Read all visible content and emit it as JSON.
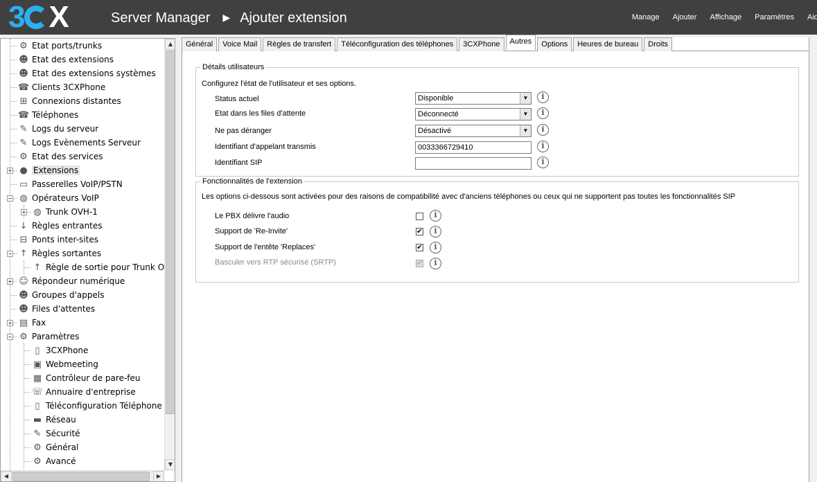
{
  "header": {
    "logo_left": "3",
    "logo_right": "X",
    "app_title": "Server Manager",
    "page_title": "Ajouter extension",
    "menu": [
      "Manage",
      "Ajouter",
      "Affichage",
      "Paramètres",
      "Aide"
    ]
  },
  "sidebar": {
    "items": [
      {
        "label": "Etat ports/trunks",
        "icon": "ports-icon"
      },
      {
        "label": "Etat des extensions",
        "icon": "extensions-status-icon"
      },
      {
        "label": "Etat des extensions systèmes",
        "icon": "system-extensions-icon"
      },
      {
        "label": "Clients 3CXPhone",
        "icon": "clients-icon"
      },
      {
        "label": "Connexions distantes",
        "icon": "network-icon"
      },
      {
        "label": "Téléphones",
        "icon": "phone-icon"
      },
      {
        "label": "Logs du serveur",
        "icon": "log-icon"
      },
      {
        "label": "Logs Evènements Serveur",
        "icon": "event-log-icon"
      },
      {
        "label": "Etat des services",
        "icon": "services-icon"
      },
      {
        "label": "Extensions",
        "icon": "user-icon"
      },
      {
        "label": "Passerelles VoIP/PSTN",
        "icon": "gateway-icon"
      },
      {
        "label": "Opérateurs VoIP",
        "icon": "globe-icon"
      },
      {
        "label": "Trunk OVH-1",
        "icon": "globe-icon"
      },
      {
        "label": "Règles entrantes",
        "icon": "arrow-down-icon"
      },
      {
        "label": "Ponts inter-sites",
        "icon": "bridge-icon"
      },
      {
        "label": "Règles sortantes",
        "icon": "arrow-up-icon"
      },
      {
        "label": "Règle de sortie pour Trunk O",
        "icon": "arrow-up-icon"
      },
      {
        "label": "Répondeur numérique",
        "icon": "ivr-icon"
      },
      {
        "label": "Groupes d'appels",
        "icon": "group-icon"
      },
      {
        "label": "Files d'attentes",
        "icon": "queue-icon"
      },
      {
        "label": "Fax",
        "icon": "fax-icon"
      },
      {
        "label": "Paramètres",
        "icon": "gear-icon"
      },
      {
        "label": "3CXPhone",
        "icon": "mobile-icon"
      },
      {
        "label": "Webmeeting",
        "icon": "webmeeting-icon"
      },
      {
        "label": "Contrôleur de pare-feu",
        "icon": "firewall-icon"
      },
      {
        "label": "Annuaire d'entreprise",
        "icon": "directory-icon"
      },
      {
        "label": "Téléconfiguration Téléphone",
        "icon": "document-icon"
      },
      {
        "label": "Réseau",
        "icon": "network-card-icon"
      },
      {
        "label": "Sécurité",
        "icon": "security-icon"
      },
      {
        "label": "Général",
        "icon": "gear-icon"
      },
      {
        "label": "Avancé",
        "icon": "gears-icon"
      }
    ]
  },
  "tabs": [
    "Général",
    "Voice Mail",
    "Règles de transfert",
    "Téléconfiguration des téléphones",
    "3CXPhone",
    "Autres",
    "Options",
    "Heures de bureau",
    "Droits"
  ],
  "user_details": {
    "legend": "Détails utilisateurs",
    "description": "Configurez l'état de l'utilisateur et ses options.",
    "status_label": "Status actuel",
    "status_value": "Disponible",
    "queue_label": "Etat dans les files d'attente",
    "queue_value": "Déconnecté",
    "dnd_label": "Ne pas déranger",
    "dnd_value": "Désactivé",
    "caller_id_label": "Identifiant d'appelant transmis",
    "caller_id_value": "0033366729410",
    "sip_id_label": "Identifiant SIP",
    "sip_id_value": ""
  },
  "features": {
    "legend": "Fonctionnalités de l'extension",
    "description": "Les options ci-dessous sont activées pour des raisons de compatibilité avec d'anciens téléphones ou ceux qui ne supportent pas toutes les fonctionnalités SIP",
    "pbx_audio_label": "Le PBX délivre l'audio",
    "reinvite_label": "Support de 'Re-Invite'",
    "replaces_label": "Support de l'entête 'Replaces'",
    "srtp_label": "Basculer vers RTP sécurisé (SRTP)",
    "checked_mark": "✔"
  },
  "icons": {
    "info": "i",
    "dropdown": "▼",
    "plus": "+",
    "minus": "−",
    "scroll_up": "▲",
    "scroll_down": "▼",
    "scroll_left": "◀",
    "scroll_right": "▶",
    "title_arrow": "▶"
  }
}
